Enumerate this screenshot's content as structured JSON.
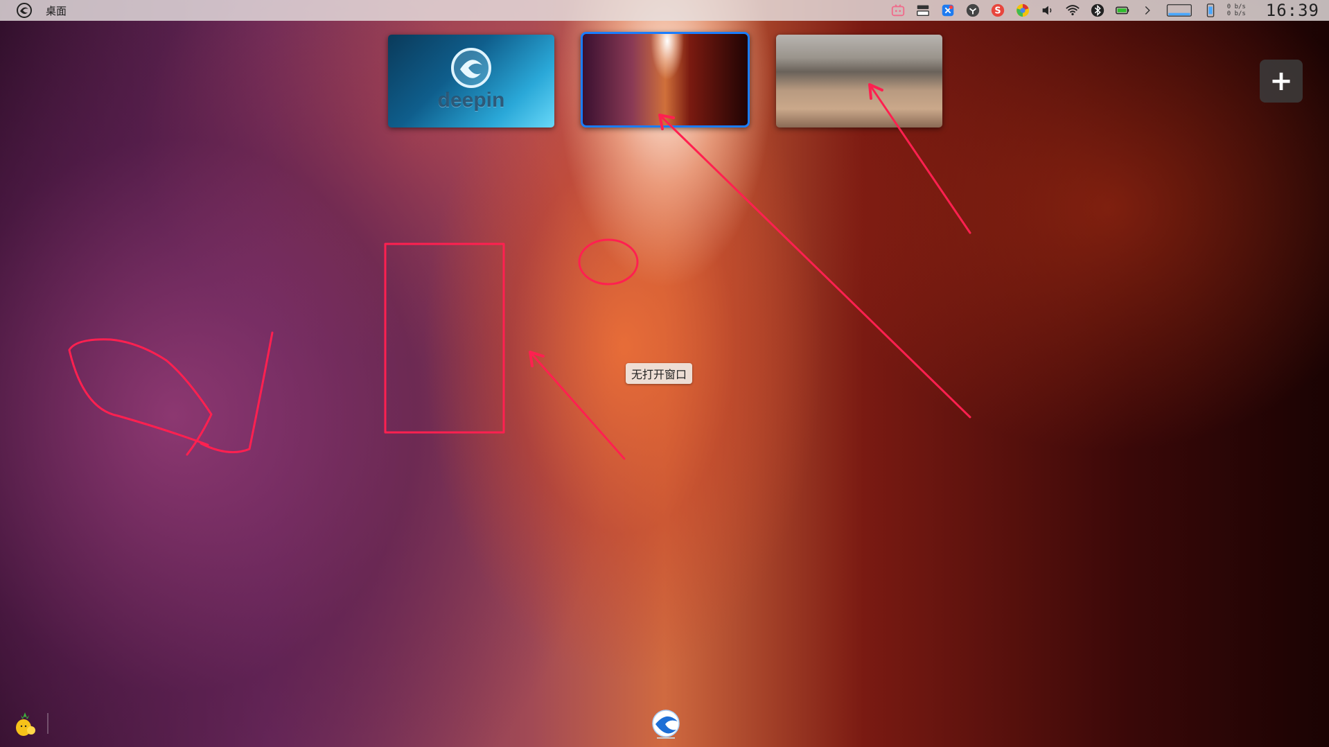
{
  "top_panel": {
    "title": "桌面",
    "launcher_icon": "deepin-logo-icon",
    "tray_icons": [
      "bilibili-icon",
      "panel-icon",
      "bluetooth-app-icon",
      "yuque-icon",
      "sogou-input-icon",
      "browser-icon",
      "volume-icon",
      "wifi-icon",
      "bluetooth-icon",
      "battery-icon",
      "expand-arrow-icon",
      "window-preview-icon",
      "phone-icon"
    ],
    "net_speed": {
      "up": "0 b/s",
      "down": "0 b/s"
    },
    "clock": "16:39"
  },
  "workspaces": {
    "ws1_text": "deepin",
    "active_index": 2,
    "add_label": "+"
  },
  "tooltip": {
    "text": "无打开窗口"
  },
  "colors": {
    "active_border": "#1a7dff",
    "annotation": "#ff2050",
    "panel_bg": "#e6e1e1"
  }
}
